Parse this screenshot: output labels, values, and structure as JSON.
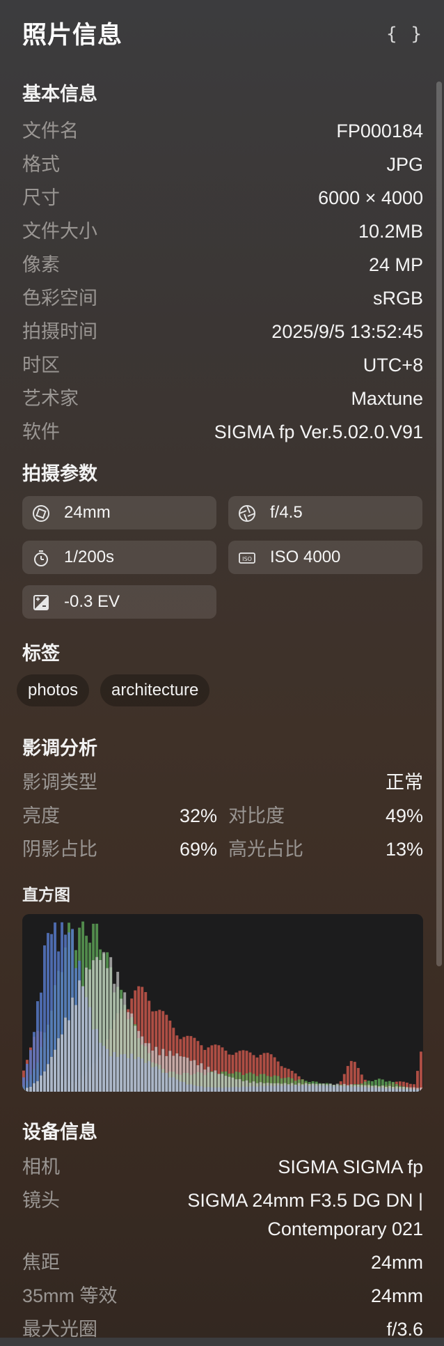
{
  "header": {
    "title": "照片信息",
    "json_button": "{ }"
  },
  "basic": {
    "title": "基本信息",
    "rows": [
      {
        "key": "文件名",
        "value": "FP000184"
      },
      {
        "key": "格式",
        "value": "JPG"
      },
      {
        "key": "尺寸",
        "value": "6000 × 4000"
      },
      {
        "key": "文件大小",
        "value": "10.2MB"
      },
      {
        "key": "像素",
        "value": "24 MP"
      },
      {
        "key": "色彩空间",
        "value": "sRGB"
      },
      {
        "key": "拍摄时间",
        "value": "2025/9/5 13:52:45"
      },
      {
        "key": "时区",
        "value": "UTC+8"
      },
      {
        "key": "艺术家",
        "value": "Maxtune"
      },
      {
        "key": "软件",
        "value": "SIGMA fp Ver.5.02.0.V91"
      }
    ]
  },
  "shooting": {
    "title": "拍摄参数",
    "chips": [
      {
        "icon": "focal-length-icon",
        "label": "24mm"
      },
      {
        "icon": "aperture-icon",
        "label": "f/4.5"
      },
      {
        "icon": "shutter-timer-icon",
        "label": "1/200s"
      },
      {
        "icon": "iso-icon",
        "label": "ISO 4000"
      },
      {
        "icon": "exposure-icon",
        "label": "-0.3 EV"
      }
    ]
  },
  "tags": {
    "title": "标签",
    "items": [
      "photos",
      "architecture"
    ]
  },
  "tone": {
    "title": "影调分析",
    "type_label": "影调类型",
    "type_value": "正常",
    "brightness_label": "亮度",
    "brightness_value": "32%",
    "contrast_label": "对比度",
    "contrast_value": "49%",
    "shadow_label": "阴影占比",
    "shadow_value": "69%",
    "highlight_label": "高光占比",
    "highlight_value": "13%"
  },
  "histogram": {
    "title": "直方图",
    "colors": {
      "red": "#c8574b",
      "green": "#5fa859",
      "blue": "#5678c7",
      "luma": "#cfcfcf",
      "background": "#1c1c1d"
    }
  },
  "device": {
    "title": "设备信息",
    "camera_label": "相机",
    "camera_value": "SIGMA SIGMA fp",
    "lens_label": "镜头",
    "lens_value_1": "SIGMA 24mm F3.5 DG DN |",
    "lens_value_2": "Contemporary 021",
    "focal_label": "焦距",
    "focal_value": "24mm",
    "eq35_label": "35mm 等效",
    "eq35_value": "24mm",
    "maxap_label": "最大光圈",
    "maxap_value": "f/3.6"
  }
}
